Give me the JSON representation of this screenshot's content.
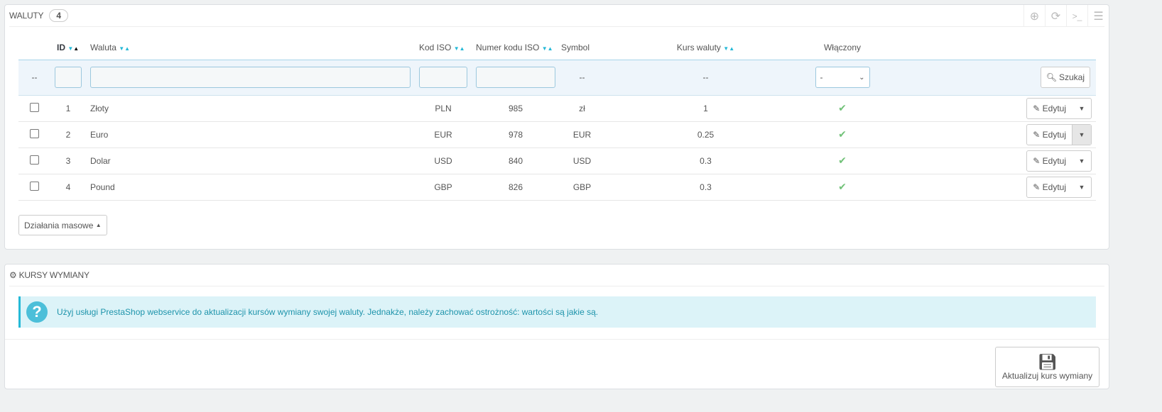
{
  "currencies_panel": {
    "title": "WALUTY",
    "count": "4",
    "toolbar": [
      "add-icon",
      "refresh-icon",
      "terminal-icon",
      "database-icon"
    ],
    "headers": {
      "id": "ID",
      "name": "Waluta",
      "iso": "Kod ISO",
      "iso_num": "Numer kodu ISO",
      "symbol": "Symbol",
      "rate": "Kurs waluty",
      "enabled": "Włączony"
    },
    "filter": {
      "dash": "--",
      "symbol_dash": "--",
      "rate_dash": "--",
      "enabled_value": "-",
      "search_label": "Szukaj"
    },
    "rows": [
      {
        "id": "1",
        "name": "Złoty",
        "iso": "PLN",
        "iso_num": "985",
        "symbol": "zł",
        "rate": "1",
        "enabled": true
      },
      {
        "id": "2",
        "name": "Euro",
        "iso": "EUR",
        "iso_num": "978",
        "symbol": "EUR",
        "rate": "0.25",
        "enabled": true
      },
      {
        "id": "3",
        "name": "Dolar",
        "iso": "USD",
        "iso_num": "840",
        "symbol": "USD",
        "rate": "0.3",
        "enabled": true
      },
      {
        "id": "4",
        "name": "Pound",
        "iso": "GBP",
        "iso_num": "826",
        "symbol": "GBP",
        "rate": "0.3",
        "enabled": true
      }
    ],
    "edit_label": "Edytuj",
    "bulk_label": "Działania masowe"
  },
  "rates_panel": {
    "title": "KURSY WYMIANY",
    "info": "Użyj usługi PrestaShop webservice do aktualizacji kursów wymiany swojej waluty. Jednakże, należy zachować ostrożność: wartości są jakie są.",
    "update_label": "Aktualizuj kurs wymiany"
  },
  "colors": {
    "accent": "#25b9d7",
    "check": "#72c279"
  }
}
